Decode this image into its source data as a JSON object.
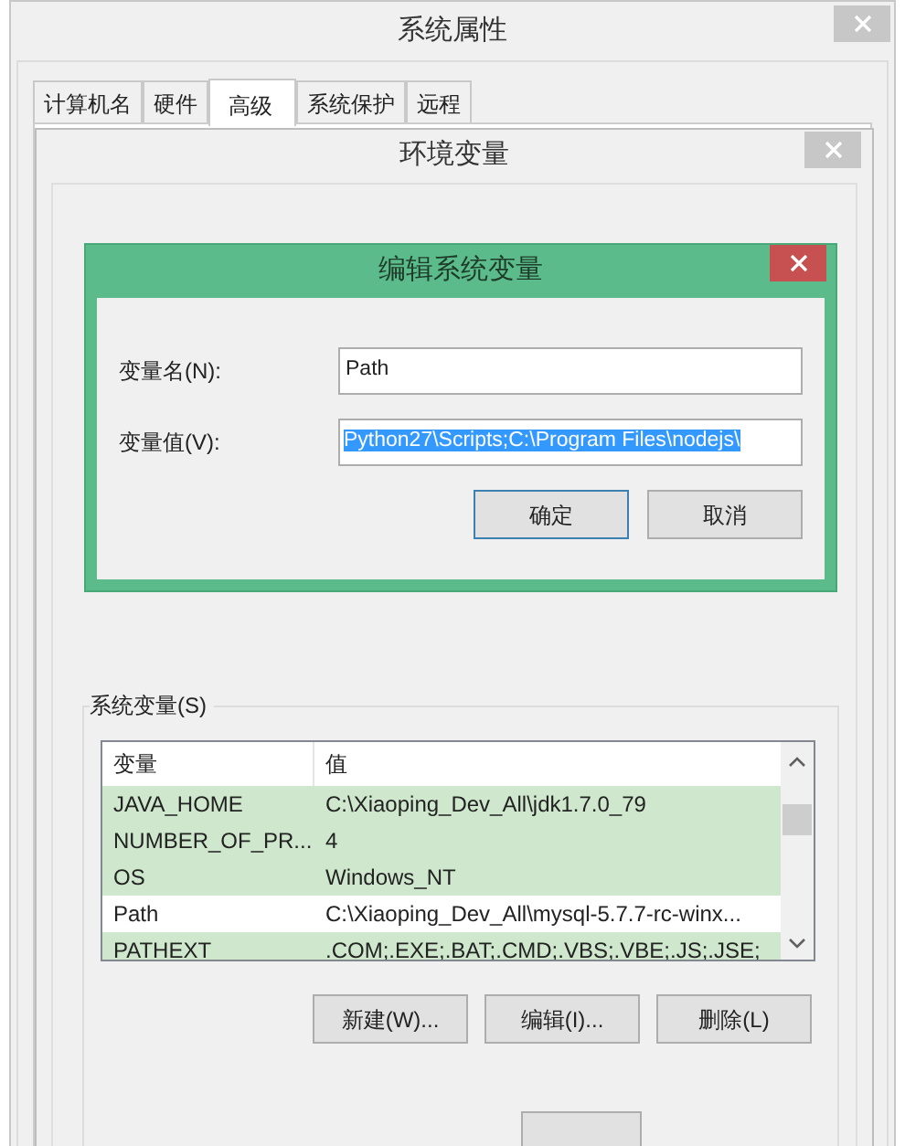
{
  "system_properties": {
    "title": "系统属性",
    "tabs": [
      {
        "label": "计算机名",
        "selected": false
      },
      {
        "label": "硬件",
        "selected": false
      },
      {
        "label": "高级",
        "selected": true
      },
      {
        "label": "系统保护",
        "selected": false
      },
      {
        "label": "远程",
        "selected": false
      }
    ]
  },
  "environment_variables": {
    "title": "环境变量",
    "system_variables": {
      "label": "系统变量(S)",
      "columns": [
        "变量",
        "值"
      ],
      "rows": [
        {
          "name": "JAVA_HOME",
          "value": "C:\\Xiaoping_Dev_All\\jdk1.7.0_79",
          "highlighted": true
        },
        {
          "name": "NUMBER_OF_PR...",
          "value": "4",
          "highlighted": true
        },
        {
          "name": "OS",
          "value": "Windows_NT",
          "highlighted": true
        },
        {
          "name": "Path",
          "value": "C:\\Xiaoping_Dev_All\\mysql-5.7.7-rc-winx...",
          "highlighted": false
        },
        {
          "name": "PATHEXT",
          "value": ".COM;.EXE;.BAT;.CMD;.VBS;.VBE;.JS;.JSE;",
          "highlighted": true
        }
      ],
      "buttons": [
        "新建(W)...",
        "编辑(I)...",
        "删除(L)"
      ]
    }
  },
  "edit_dialog": {
    "title": "编辑系统变量",
    "fields": [
      {
        "label": "变量名(N):",
        "value": "Path",
        "selected": false
      },
      {
        "label": "变量值(V):",
        "value": "Python27\\Scripts;C:\\Program Files\\nodejs\\",
        "selected": true
      }
    ],
    "buttons": [
      {
        "label": "确定",
        "default": true
      },
      {
        "label": "取消",
        "default": false
      }
    ]
  }
}
